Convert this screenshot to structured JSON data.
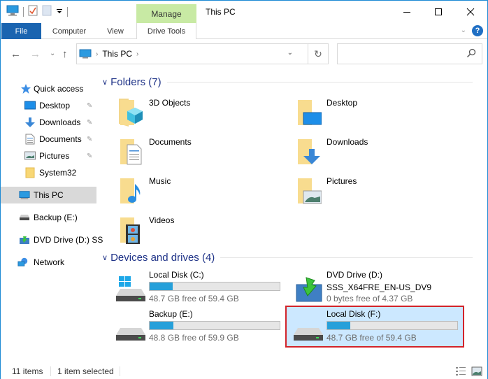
{
  "window": {
    "title": "This PC",
    "context_tab": "Manage",
    "accent_color": "#1a64b0",
    "context_tab_color": "#c8eaa4",
    "controls": {
      "minimize": "—",
      "maximize": "☐",
      "close": "✕"
    }
  },
  "ribbon": {
    "tabs": [
      {
        "label": "File"
      },
      {
        "label": "Computer"
      },
      {
        "label": "View"
      },
      {
        "label": "Drive Tools"
      }
    ],
    "help_label": "?"
  },
  "navigation": {
    "back_icon": "←",
    "forward_icon": "→",
    "recent_icon": "⌄",
    "up_icon": "↑",
    "breadcrumb": [
      "This PC"
    ],
    "breadcrumb_arrow": "›",
    "dropdown_icon": "⌄",
    "refresh_icon": "↻",
    "search_placeholder": "",
    "search_icon": "⚲"
  },
  "sidebar": {
    "items": [
      {
        "label": "Quick access",
        "icon": "star-icon"
      },
      {
        "label": "Desktop",
        "icon": "desktop-icon",
        "pinned": true
      },
      {
        "label": "Downloads",
        "icon": "download-icon",
        "pinned": true
      },
      {
        "label": "Documents",
        "icon": "document-icon",
        "pinned": true
      },
      {
        "label": "Pictures",
        "icon": "pictures-icon",
        "pinned": true
      },
      {
        "label": "System32",
        "icon": "folder-icon"
      },
      {
        "label": "This PC",
        "icon": "computer-icon",
        "selected": true
      },
      {
        "label": "Backup (E:)",
        "icon": "drive-icon"
      },
      {
        "label": "DVD Drive (D:) SS",
        "icon": "dvd-icon"
      },
      {
        "label": "Network",
        "icon": "network-icon"
      }
    ],
    "pin_glyph": "📌"
  },
  "main": {
    "folders_header": "Folders (7)",
    "folders": [
      {
        "name": "3D Objects",
        "icon": "3d-objects-icon"
      },
      {
        "name": "Desktop",
        "icon": "desktop-folder-icon"
      },
      {
        "name": "Documents",
        "icon": "documents-folder-icon"
      },
      {
        "name": "Downloads",
        "icon": "downloads-folder-icon"
      },
      {
        "name": "Music",
        "icon": "music-folder-icon"
      },
      {
        "name": "Pictures",
        "icon": "pictures-folder-icon"
      },
      {
        "name": "Videos",
        "icon": "videos-folder-icon"
      }
    ],
    "drives_header": "Devices and drives (4)",
    "drives": [
      {
        "name": "Local Disk (C:)",
        "free_text": "48.7 GB free of 59.4 GB",
        "used_fraction": 0.18,
        "icon": "windows-drive-icon"
      },
      {
        "name": "DVD Drive (D:)",
        "subtitle": "SSS_X64FRE_EN-US_DV9",
        "free_text": "0 bytes free of 4.37 GB",
        "icon": "dvd-drive-icon"
      },
      {
        "name": "Backup (E:)",
        "free_text": "48.8 GB free of 59.9 GB",
        "used_fraction": 0.185,
        "icon": "drive-icon"
      },
      {
        "name": "Local Disk (F:)",
        "free_text": "48.7 GB free of 59.4 GB",
        "used_fraction": 0.18,
        "icon": "drive-icon",
        "selected": true
      }
    ],
    "bar_color": "#26a0da",
    "highlight_color": "#d2232a"
  },
  "status": {
    "item_count": "11 items",
    "selection": "1 item selected"
  }
}
